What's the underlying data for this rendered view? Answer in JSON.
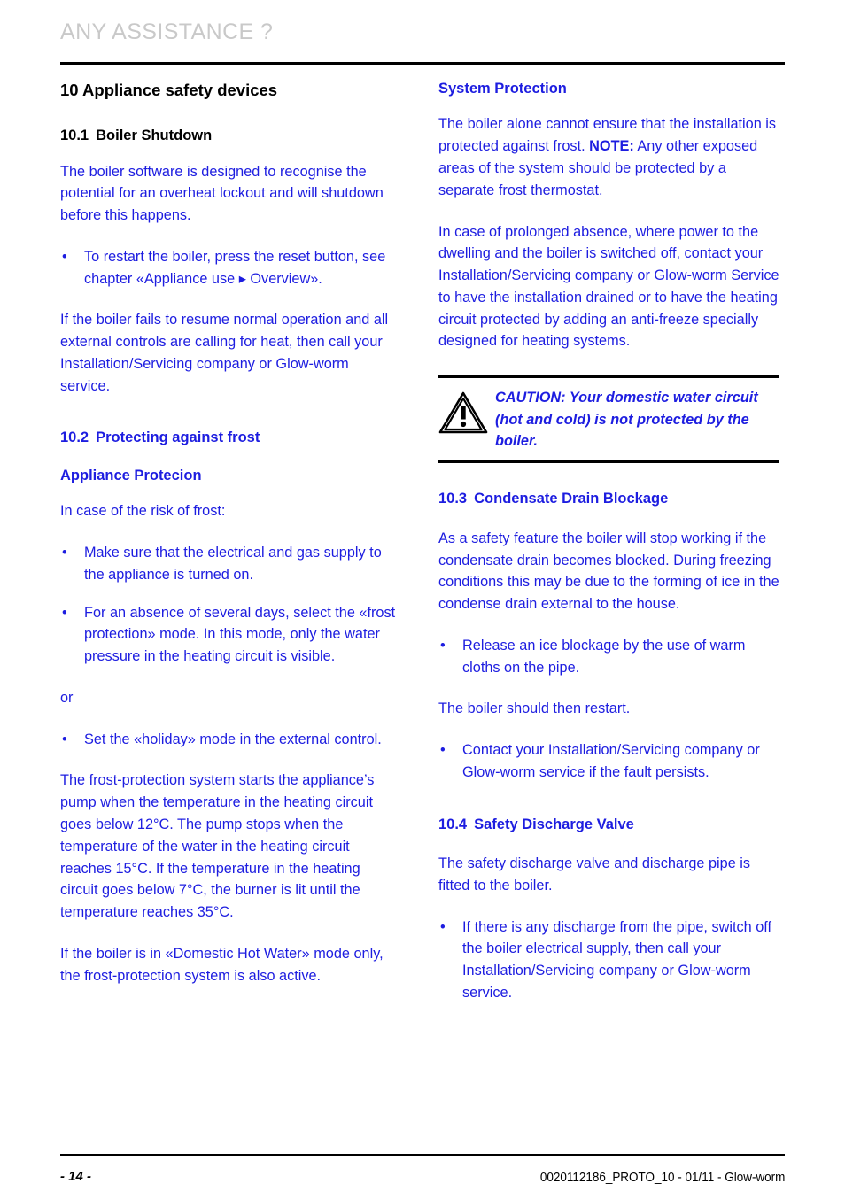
{
  "header": {
    "running_title": "ANY ASSISTANCE ?"
  },
  "left_column": {
    "chapter_heading": "10 Appliance safety devices",
    "section_10_1": {
      "number": "10.1",
      "title": "Boiler Shutdown",
      "paragraph_1": "The boiler software is designed to recognise the potential for an overheat lockout and will shutdown before this happens.",
      "bullet_1": "To restart the boiler, press the reset button, see chapter «Appliance use ▸ Overview».",
      "paragraph_2": "If the boiler fails to resume normal operation and all external controls are calling for heat, then call your Installation/Servicing company or Glow-worm service."
    },
    "section_10_2": {
      "number": "10.2",
      "title": "Protecting against frost",
      "subheading": "Appliance Protecion",
      "intro": "In case of the risk of frost:",
      "bullet_1": "Make sure that the electrical and gas supply to the appliance is turned on.",
      "bullet_2": "For an absence of several days, select the «frost protection» mode. In this mode, only the water pressure in the heating circuit is visible.",
      "or_label": "or",
      "bullet_3": "Set the «holiday» mode in the external control.",
      "paragraph_frost": "The frost-protection system starts the appliance’s pump when the temperature in the heating circuit goes below 12°C. The pump stops when the temperature of the water in the heating circuit reaches 15°C. If the temperature in the heating circuit goes below 7°C, the burner is lit until the temperature reaches 35°C.",
      "paragraph_dhw": "If the boiler is in «Domestic Hot Water» mode only, the frost-protection system is also active.",
      "temperatures": {
        "pump_start_below": "12°C",
        "pump_stop_at": "15°C",
        "burner_light_below": "7°C",
        "burner_stop_at": "35°C"
      }
    }
  },
  "right_column": {
    "system_protection": {
      "heading": "System Protection",
      "paragraph_1_pre": "The boiler alone cannot ensure that the installation is protected against frost. ",
      "paragraph_1_note_label": "NOTE:",
      "paragraph_1_post": " Any other exposed areas of the system should be protected by a separate frost thermostat.",
      "paragraph_2": "In case of prolonged absence, where power to the dwelling and the boiler is switched off, contact your Installation/Servicing company or Glow-worm Service to have the installation drained or to have the heating circuit protected by adding an anti-freeze specially designed for heating systems."
    },
    "caution": {
      "icon": "warning-triangle-icon",
      "text": "CAUTION: Your domestic water circuit (hot and cold) is not protected by the boiler."
    },
    "section_10_3": {
      "number": "10.3",
      "title": "Condensate Drain Blockage",
      "paragraph_1": "As a safety feature the boiler will stop working if the condensate drain becomes blocked. During freezing conditions this may be due to the forming of ice in the condense drain external to the house.",
      "bullet_1": "Release an ice blockage by the use of warm cloths on the pipe.",
      "paragraph_2": "The boiler should then restart.",
      "bullet_2": "Contact your Installation/Servicing company or Glow-worm service if the fault persists."
    },
    "section_10_4": {
      "number": "10.4",
      "title": "Safety Discharge Valve",
      "paragraph_1": "The safety discharge valve and discharge pipe is fitted to the boiler.",
      "bullet_1": "If there is any discharge from the pipe, switch off the boiler electrical supply, then call your Installation/Servicing company or Glow-worm service."
    }
  },
  "footer": {
    "page_number": "- 14 -",
    "document_reference": "0020112186_PROTO_10 - 01/11 - Glow-worm"
  },
  "colors": {
    "body_blue": "#1d1de0",
    "heading_black": "#000000",
    "running_head_gray": "#c9c9c9"
  },
  "bullet_glyph": "•"
}
